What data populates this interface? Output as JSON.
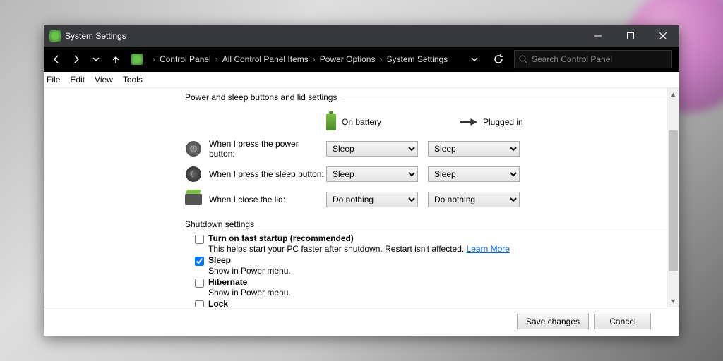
{
  "window": {
    "title": "System Settings"
  },
  "breadcrumbs": [
    "Control Panel",
    "All Control Panel Items",
    "Power Options",
    "System Settings"
  ],
  "search": {
    "placeholder": "Search Control Panel"
  },
  "menu": {
    "file": "File",
    "edit": "Edit",
    "view": "View",
    "tools": "Tools"
  },
  "group1": {
    "title": "Power and sleep buttons and lid settings",
    "col_battery": "On battery",
    "col_plugged": "Plugged in",
    "rows": {
      "power": {
        "label": "When I press the power button:",
        "battery": "Sleep",
        "plugged": "Sleep"
      },
      "sleep": {
        "label": "When I press the sleep button:",
        "battery": "Sleep",
        "plugged": "Sleep"
      },
      "lid": {
        "label": "When I close the lid:",
        "battery": "Do nothing",
        "plugged": "Do nothing"
      }
    }
  },
  "group2": {
    "title": "Shutdown settings",
    "fast": {
      "label": "Turn on fast startup (recommended)",
      "desc": "This helps start your PC faster after shutdown. Restart isn't affected. ",
      "link": "Learn More",
      "checked": false
    },
    "sleep": {
      "label": "Sleep",
      "desc": "Show in Power menu.",
      "checked": true
    },
    "hib": {
      "label": "Hibernate",
      "desc": "Show in Power menu.",
      "checked": false
    },
    "lock": {
      "label": "Lock",
      "checked": false
    }
  },
  "footer": {
    "save": "Save changes",
    "cancel": "Cancel"
  }
}
